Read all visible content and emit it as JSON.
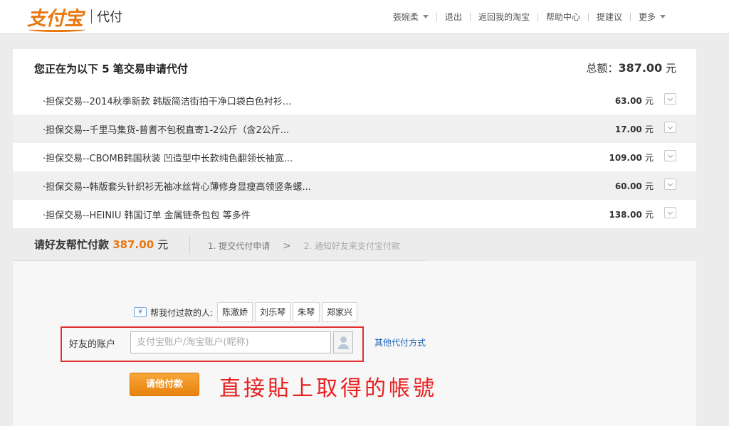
{
  "header": {
    "logo": "支付宝",
    "section": "代付",
    "nav": [
      {
        "label": "張婉柔",
        "dropdown": true
      },
      {
        "label": "退出",
        "dropdown": false
      },
      {
        "label": "返回我的淘宝",
        "dropdown": false
      },
      {
        "label": "帮助中心",
        "dropdown": false
      },
      {
        "label": "提建议",
        "dropdown": false
      },
      {
        "label": "更多",
        "dropdown": true
      }
    ]
  },
  "order": {
    "title": "您正在为以下 5 笔交易申请代付",
    "total_label": "总额：",
    "total_value": "387.00",
    "total_unit": "元",
    "items": [
      {
        "name": "·担保交易--2014秋季新款 韩版简洁街拍干净口袋白色衬衫...",
        "amount": "63.00",
        "unit": "元"
      },
      {
        "name": "·担保交易--千里马集货-普耆不包税直寄1-2公斤（含2公斤...",
        "amount": "17.00",
        "unit": "元"
      },
      {
        "name": "·担保交易--CBOMB韩国秋装 凹造型中长款纯色翻领长袖宽...",
        "amount": "109.00",
        "unit": "元"
      },
      {
        "name": "·担保交易--韩版套头针织衫无袖冰丝背心薄修身显瘦高领竖条螺...",
        "amount": "60.00",
        "unit": "元"
      },
      {
        "name": "·担保交易--HEINIU 韩国订单 金属链条包包 等多件",
        "amount": "138.00",
        "unit": "元"
      }
    ]
  },
  "payrequest": {
    "title": "请好友帮忙付款",
    "amount": "387.00",
    "unit": "元",
    "step1": "1. 提交代付申请",
    "arrow": ">",
    "step2": "2. 通知好友来支付宝付款"
  },
  "helpers": {
    "icon_text": "¥",
    "label": "帮我付过款的人:",
    "people": [
      "陈澈娇",
      "刘乐琴",
      "朱琴",
      "郑家兴"
    ]
  },
  "account": {
    "label": "好友的账户",
    "placeholder": "支付宝账户/淘宝账户(昵称)",
    "value": ""
  },
  "other_link": "其他代付方式",
  "pay_button": "请他付款",
  "annotation": "直接貼上取得的帳號",
  "colors": {
    "brand_orange": "#e87810",
    "link_blue": "#1a5fb4",
    "highlight_red": "#e03030"
  }
}
